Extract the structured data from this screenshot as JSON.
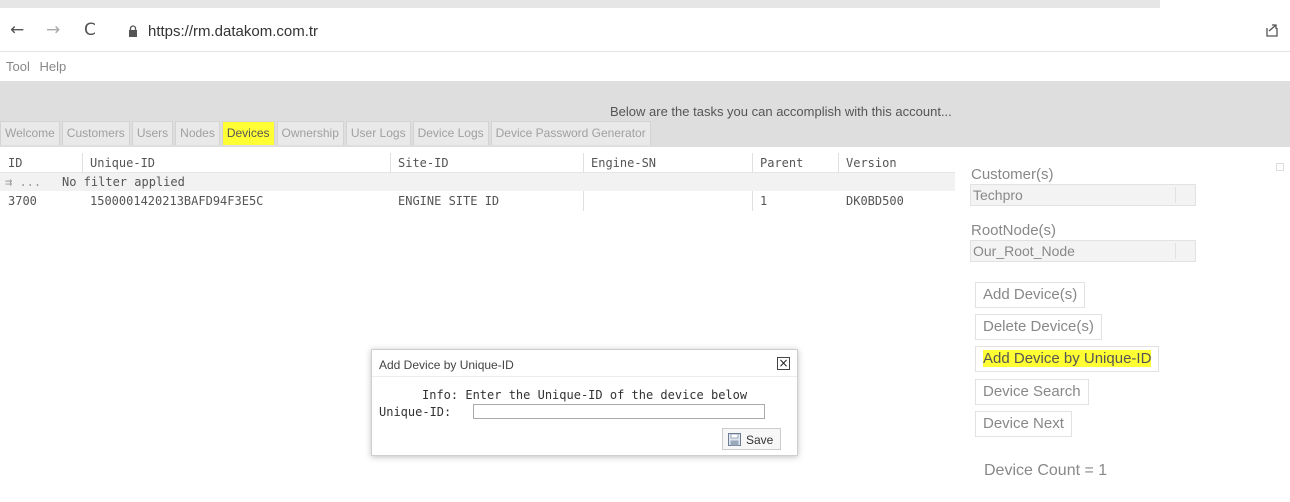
{
  "browser": {
    "url": "https://rm.datakom.com.tr"
  },
  "menu": {
    "items": [
      "Tool",
      "Help"
    ]
  },
  "banner": {
    "message": "Below are the tasks you can accomplish with this account..."
  },
  "tabs": [
    "Welcome",
    "Customers",
    "Users",
    "Nodes",
    "Devices",
    "Ownership",
    "User Logs",
    "Device Logs",
    "Device Password Generator"
  ],
  "active_tab": "Devices",
  "grid": {
    "columns": [
      "ID",
      "Unique-ID",
      "Site-ID",
      "Engine-SN",
      "Parent",
      "Version"
    ],
    "filter_prefix": "⇉ ...",
    "filter_text": "No filter applied",
    "rows": [
      [
        "3700",
        "1500001420213BAFD94F3E5C",
        "ENGINE SITE ID",
        "",
        "1",
        "DK0BD500"
      ]
    ]
  },
  "panel": {
    "customer_label": "Customer(s)",
    "customer_value": "Techpro",
    "rootnode_label": "RootNode(s)",
    "rootnode_value": "Our_Root_Node",
    "buttons": [
      "Add Device(s)",
      "Delete Device(s)",
      "Add Device by Unique-ID",
      "Device Search",
      "Device Next"
    ],
    "device_count": "Device Count = 1"
  },
  "dialog": {
    "title": "Add Device by Unique-ID",
    "info": "Info: Enter the Unique-ID of the device below",
    "field_label": "Unique-ID:",
    "field_value": "",
    "save_label": "Save"
  },
  "colors": {
    "highlight": "#ffff33",
    "banner": "#dedede"
  }
}
